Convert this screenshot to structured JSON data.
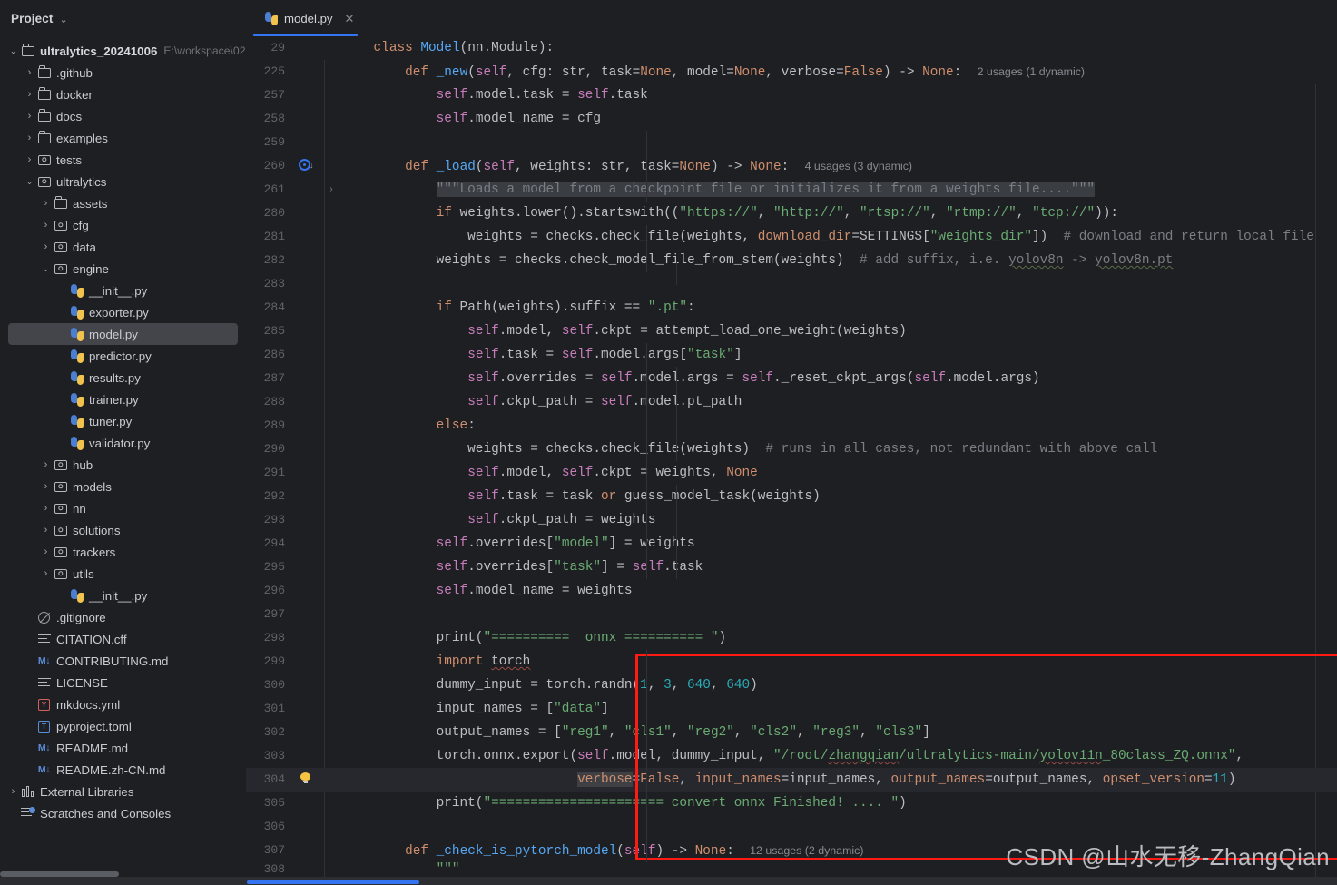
{
  "sidebar": {
    "title": "Project",
    "chevron": "⌄",
    "scrollbar": "horizontal-scrollbar",
    "tree": [
      {
        "depth": 0,
        "arrow": "open",
        "icon": "folder",
        "label": "ultralytics_20241006",
        "sub": "E:\\workspace\\02",
        "bold": true
      },
      {
        "depth": 1,
        "arrow": "closed",
        "icon": "folder",
        "label": ".github"
      },
      {
        "depth": 1,
        "arrow": "closed",
        "icon": "folder",
        "label": "docker"
      },
      {
        "depth": 1,
        "arrow": "closed",
        "icon": "folder",
        "label": "docs"
      },
      {
        "depth": 1,
        "arrow": "closed",
        "icon": "folder",
        "label": "examples"
      },
      {
        "depth": 1,
        "arrow": "closed",
        "icon": "package",
        "label": "tests"
      },
      {
        "depth": 1,
        "arrow": "open",
        "icon": "package",
        "label": "ultralytics"
      },
      {
        "depth": 2,
        "arrow": "closed",
        "icon": "folder",
        "label": "assets"
      },
      {
        "depth": 2,
        "arrow": "closed",
        "icon": "package",
        "label": "cfg"
      },
      {
        "depth": 2,
        "arrow": "closed",
        "icon": "package",
        "label": "data"
      },
      {
        "depth": 2,
        "arrow": "open",
        "icon": "package",
        "label": "engine"
      },
      {
        "depth": 3,
        "arrow": "none",
        "icon": "python",
        "label": "__init__.py"
      },
      {
        "depth": 3,
        "arrow": "none",
        "icon": "python",
        "label": "exporter.py"
      },
      {
        "depth": 3,
        "arrow": "none",
        "icon": "python",
        "label": "model.py",
        "selected": true
      },
      {
        "depth": 3,
        "arrow": "none",
        "icon": "python",
        "label": "predictor.py"
      },
      {
        "depth": 3,
        "arrow": "none",
        "icon": "python",
        "label": "results.py"
      },
      {
        "depth": 3,
        "arrow": "none",
        "icon": "python",
        "label": "trainer.py"
      },
      {
        "depth": 3,
        "arrow": "none",
        "icon": "python",
        "label": "tuner.py"
      },
      {
        "depth": 3,
        "arrow": "none",
        "icon": "python",
        "label": "validator.py"
      },
      {
        "depth": 2,
        "arrow": "closed",
        "icon": "package",
        "label": "hub"
      },
      {
        "depth": 2,
        "arrow": "closed",
        "icon": "package",
        "label": "models"
      },
      {
        "depth": 2,
        "arrow": "closed",
        "icon": "package",
        "label": "nn"
      },
      {
        "depth": 2,
        "arrow": "closed",
        "icon": "package",
        "label": "solutions"
      },
      {
        "depth": 2,
        "arrow": "closed",
        "icon": "package",
        "label": "trackers"
      },
      {
        "depth": 2,
        "arrow": "closed",
        "icon": "package",
        "label": "utils"
      },
      {
        "depth": 3,
        "arrow": "none",
        "icon": "python",
        "label": "__init__.py"
      },
      {
        "depth": 1,
        "arrow": "none",
        "icon": "gitignore",
        "label": ".gitignore"
      },
      {
        "depth": 1,
        "arrow": "none",
        "icon": "textlines",
        "label": "CITATION.cff"
      },
      {
        "depth": 1,
        "arrow": "none",
        "icon": "markdown",
        "label": "CONTRIBUTING.md"
      },
      {
        "depth": 1,
        "arrow": "none",
        "icon": "textlines",
        "label": "LICENSE"
      },
      {
        "depth": 1,
        "arrow": "none",
        "icon": "yaml",
        "label": "mkdocs.yml"
      },
      {
        "depth": 1,
        "arrow": "none",
        "icon": "toml",
        "label": "pyproject.toml"
      },
      {
        "depth": 1,
        "arrow": "none",
        "icon": "markdown",
        "label": "README.md"
      },
      {
        "depth": 1,
        "arrow": "none",
        "icon": "markdown",
        "label": "README.zh-CN.md"
      },
      {
        "depth": 0,
        "arrow": "closed",
        "icon": "external-libraries",
        "label": "External Libraries"
      },
      {
        "depth": 0,
        "arrow": "none",
        "icon": "scratches",
        "label": "Scratches and Consoles"
      }
    ]
  },
  "editor": {
    "tab": {
      "label": "model.py",
      "icon": "python-file-icon",
      "close": "✕"
    },
    "watermark": "CSDN @山水无移-ZhangQian",
    "sticky_headers": [
      {
        "num": "29",
        "indent": 1,
        "text": "class Model(nn.Module):"
      },
      {
        "num": "225",
        "indent": 2,
        "text": "def _new(self, cfg: str, task=None, model=None, verbose=False) -> None:",
        "usages": "2 usages (1 dynamic)"
      }
    ],
    "lines": [
      {
        "num": "257"
      },
      {
        "num": "258"
      },
      {
        "num": "259"
      },
      {
        "num": "260",
        "usages": "4 usages (3 dynamic)",
        "gutter_icon": "run-target-icon"
      },
      {
        "num": "261",
        "fold": "›"
      },
      {
        "num": "280"
      },
      {
        "num": "281"
      },
      {
        "num": "282"
      },
      {
        "num": "283"
      },
      {
        "num": "284"
      },
      {
        "num": "285"
      },
      {
        "num": "286"
      },
      {
        "num": "287"
      },
      {
        "num": "288"
      },
      {
        "num": "289"
      },
      {
        "num": "290"
      },
      {
        "num": "291"
      },
      {
        "num": "292"
      },
      {
        "num": "293"
      },
      {
        "num": "294"
      },
      {
        "num": "295"
      },
      {
        "num": "296"
      },
      {
        "num": "297"
      },
      {
        "num": "298"
      },
      {
        "num": "299"
      },
      {
        "num": "300"
      },
      {
        "num": "301"
      },
      {
        "num": "302"
      },
      {
        "num": "303"
      },
      {
        "num": "304",
        "gutter_icon": "lightbulb-icon",
        "highlighted": true
      },
      {
        "num": "305"
      },
      {
        "num": "306"
      },
      {
        "num": "307",
        "usages": "12 usages (2 dynamic)"
      },
      {
        "num": "308"
      }
    ],
    "code_text": {
      "l257": "self.model.task = self.task",
      "l258": "self.model_name = cfg",
      "l260": "def _load(self, weights: str, task=None) -> None:",
      "l261": "\"\"\"Loads a model from a checkpoint file or initializes it from a weights file....\"\"\"",
      "l280": "if weights.lower().startswith((\"https://\", \"http://\", \"rtsp://\", \"rtmp://\", \"tcp://\")):",
      "l281": "weights = checks.check_file(weights, download_dir=SETTINGS[\"weights_dir\"])  # download and return local file",
      "l282": "weights = checks.check_model_file_from_stem(weights)  # add suffix, i.e. yolov8n -> yolov8n.pt",
      "l284": "if Path(weights).suffix == \".pt\":",
      "l285": "self.model, self.ckpt = attempt_load_one_weight(weights)",
      "l286": "self.task = self.model.args[\"task\"]",
      "l287": "self.overrides = self.model.args = self._reset_ckpt_args(self.model.args)",
      "l288": "self.ckpt_path = self.model.pt_path",
      "l289": "else:",
      "l290": "weights = checks.check_file(weights)  # runs in all cases, not redundant with above call",
      "l291": "self.model, self.ckpt = weights, None",
      "l292": "self.task = task or guess_model_task(weights)",
      "l293": "self.ckpt_path = weights",
      "l294": "self.overrides[\"model\"] = weights",
      "l295": "self.overrides[\"task\"] = self.task",
      "l296": "self.model_name = weights",
      "l298": "print(\"==========  onnx ========== \")",
      "l299": "import torch",
      "l300": "dummy_input = torch.randn(1, 3, 640, 640)",
      "l301": "input_names = [\"data\"]",
      "l302": "output_names = [\"reg1\", \"cls1\", \"reg2\", \"cls2\", \"reg3\", \"cls3\"]",
      "l303": "torch.onnx.export(self.model, dummy_input, \"/root/zhangqian/ultralytics-main/yolov11n_80class_ZQ.onnx\",",
      "l304": "verbose=False, input_names=input_names, output_names=output_names, opset_version=11)",
      "l305": "print(\"====================== convert onnx Finished! .... \")",
      "l307": "def _check_is_pytorch_model(self) -> None:",
      "l308": "\"\"\""
    },
    "annotation_box": {
      "name": "red-highlight-box",
      "color": "#ff1b14"
    }
  },
  "colors": {
    "background": "#1e1f22",
    "sidebar_selected": "#43454a",
    "tab_accent": "#3574f0",
    "keyword": "#cf8e6d",
    "string": "#6aab73",
    "number": "#2aacb8",
    "comment": "#7a7e85",
    "function": "#56a8f5",
    "self": "#c77dbb",
    "plain": "#bcbec4",
    "annotation_red": "#ff1b14"
  }
}
